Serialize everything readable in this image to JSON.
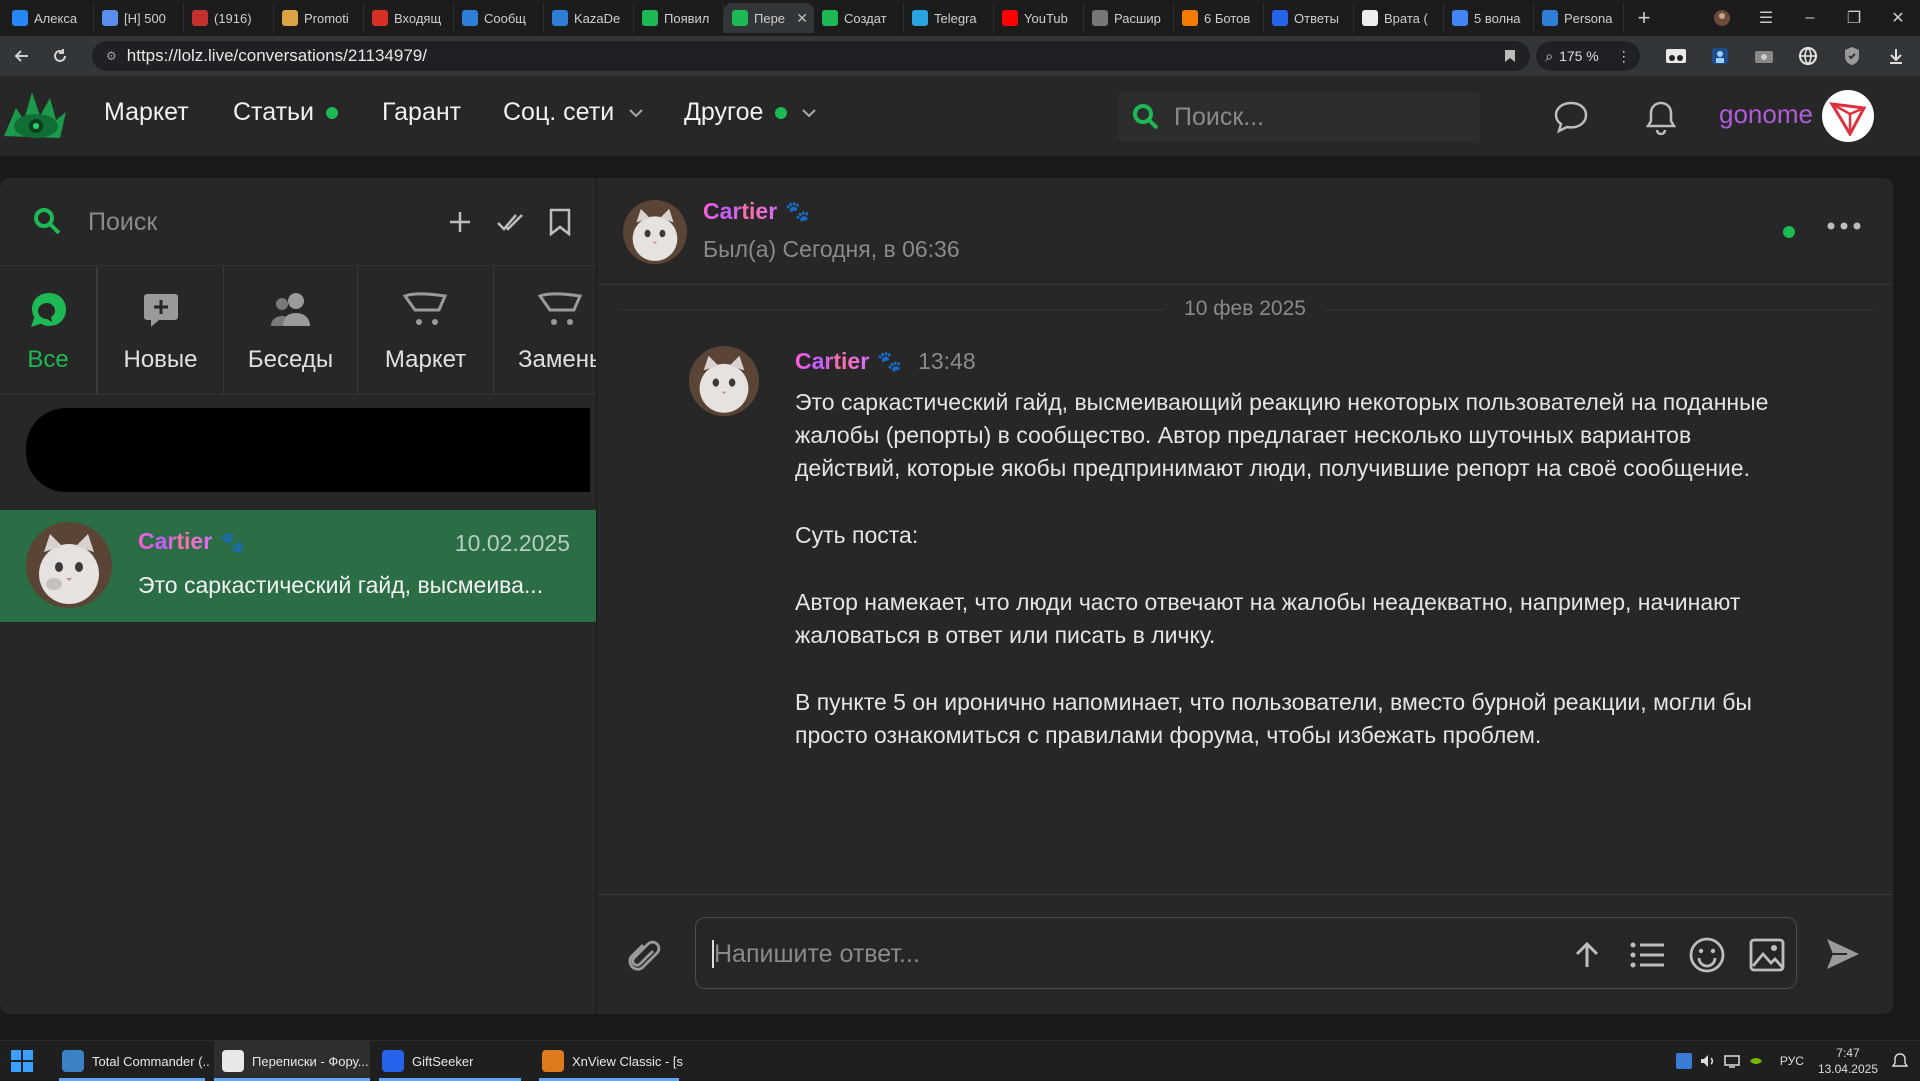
{
  "browser": {
    "tabs": [
      {
        "title": "Алекса",
        "favicon": "vk-icon",
        "color": "#2787f5",
        "active": false
      },
      {
        "title": "[H] 500",
        "favicon": "generic-icon",
        "color": "#5a8dee",
        "active": false
      },
      {
        "title": "(1916)",
        "favicon": "youtube-icon",
        "color": "#c4302b",
        "active": false
      },
      {
        "title": "Promoti",
        "favicon": "coin-icon",
        "color": "#d9a441",
        "active": false
      },
      {
        "title": "Входящ",
        "favicon": "gmail-icon",
        "color": "#d93025",
        "active": false
      },
      {
        "title": "Сообщ",
        "favicon": "lolz-icon",
        "color": "#2e7dd7",
        "active": false
      },
      {
        "title": "KazaDe",
        "favicon": "lolz-icon",
        "color": "#2e7dd7",
        "active": false
      },
      {
        "title": "Появил",
        "favicon": "lolz-green-icon",
        "color": "#1db954",
        "active": false
      },
      {
        "title": "Пере",
        "favicon": "lolz-green-icon",
        "color": "#1db954",
        "active": true
      },
      {
        "title": "Создат",
        "favicon": "lolz-green-icon",
        "color": "#1db954",
        "active": false
      },
      {
        "title": "Telegra",
        "favicon": "telegram-icon",
        "color": "#2aa3df",
        "active": false
      },
      {
        "title": "YouTub",
        "favicon": "youtube-icon",
        "color": "#ff0000",
        "active": false
      },
      {
        "title": "Расшир",
        "favicon": "puzzle-icon",
        "color": "#777777",
        "active": false
      },
      {
        "title": "6 Ботов",
        "favicon": "orange-icon",
        "color": "#f57c00",
        "active": false
      },
      {
        "title": "Ответы",
        "favicon": "answers-icon",
        "color": "#2563eb",
        "active": false
      },
      {
        "title": "Врата (",
        "favicon": "wikipedia-icon",
        "color": "#eeeeee",
        "active": false
      },
      {
        "title": "5 волна",
        "favicon": "google-icon",
        "color": "#4285f4",
        "active": false
      },
      {
        "title": "Persona",
        "favicon": "lolz-icon",
        "color": "#2e7dd7",
        "active": false
      }
    ],
    "url": "https://lolz.live/conversations/21134979/",
    "zoom": "175 %"
  },
  "site": {
    "nav": {
      "market": "Маркет",
      "articles": "Статьи",
      "guarantor": "Гарант",
      "social": "Соц. сети",
      "other": "Другое"
    },
    "search_placeholder": "Поиск...",
    "username": "gonome",
    "accent": "#1db954",
    "username_color": "#b05cd8"
  },
  "conversations": {
    "search_placeholder": "Поиск",
    "filters": [
      {
        "label": "Все",
        "active": true
      },
      {
        "label": "Новые",
        "active": false
      },
      {
        "label": "Беседы",
        "active": false
      },
      {
        "label": "Маркет",
        "active": false
      },
      {
        "label": "Замены",
        "active": false
      }
    ],
    "items": [
      {
        "name": "Cartier",
        "date": "10.02.2025",
        "preview": "Это саркастический гайд, высмеива..."
      }
    ],
    "selected_color": "#2b6e45"
  },
  "chat": {
    "recipient": {
      "name": "Cartier",
      "last_seen": "Был(а) Сегодня, в 06:36"
    },
    "date_separator": "10 фев 2025",
    "message": {
      "author": "Cartier",
      "time": "13:48",
      "paragraphs": [
        "Это саркастический гайд, высмеивающий реакцию некоторых пользователей на поданные жалобы (репорты) в сообщество. Автор предлагает несколько шуточных вариантов действий, которые якобы предпринимают люди, получившие репорт на своё сообщение.",
        "Суть поста:",
        "Автор намекает, что люди часто отвечают на жалобы неадекватно, например, начинают жаловаться в ответ или писать в личку.",
        "В пункте 5 он иронично напоминает, что пользователи, вместо бурной реакции, могли бы просто ознакомиться с правилами форума, чтобы избежать проблем."
      ]
    },
    "composer_placeholder": "Напишите ответ..."
  },
  "taskbar": {
    "apps": [
      {
        "label": "Total Commander (...",
        "color": "#3b82c4",
        "active": false
      },
      {
        "label": "Переписки - Фору...",
        "color": "#e8e8e8",
        "active": true
      },
      {
        "label": "GiftSeeker",
        "color": "#2563eb",
        "active": false
      },
      {
        "label": "XnView Classic - [s...",
        "color": "#e07a1f",
        "active": false
      }
    ],
    "language": "РУС",
    "time": "7:47",
    "date": "13.04.2025"
  }
}
